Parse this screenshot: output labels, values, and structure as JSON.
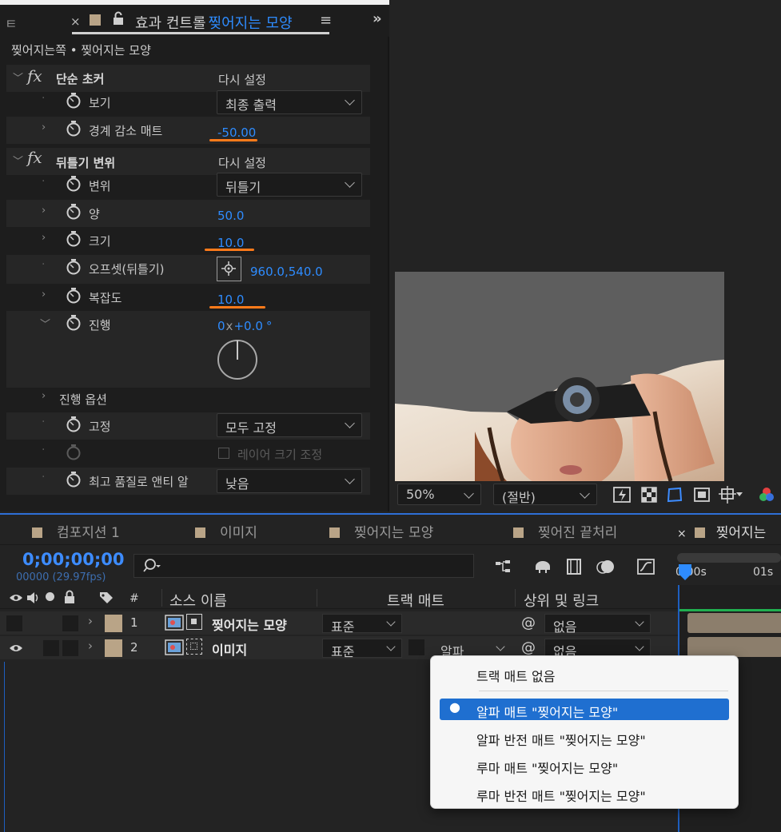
{
  "effect_panel": {
    "tab_left_fragment": "ㅌ",
    "tab_title_prefix": "효과 컨트롤",
    "tab_title_layer": "찢어지는 모양",
    "breadcrumb": "찢어지는쪽 • 찢어지는 모양",
    "effects": [
      {
        "name": "단순 초커",
        "reset": "다시 설정",
        "props": [
          {
            "label": "보기",
            "value": "최종 출력"
          },
          {
            "label": "경계 감소 매트",
            "value": "-50.00"
          }
        ]
      },
      {
        "name": "뒤틀기 변위",
        "reset": "다시 설정",
        "props": [
          {
            "label": "변위",
            "value": "뒤틀기"
          },
          {
            "label": "양",
            "value": "50.0"
          },
          {
            "label": "크기",
            "value": "10.0"
          },
          {
            "label": "오프셋(뒤틀기)",
            "value_x": "960.0",
            "value_y": ",540.0"
          },
          {
            "label": "복잡도",
            "value": "10.0"
          },
          {
            "label": "진행",
            "value_a": "0",
            "value_b": "x",
            "value_c": "+0.0",
            "value_d": "°"
          },
          {
            "label": "진행 옵션"
          },
          {
            "label": "고정",
            "value": "모두 고정"
          },
          {
            "label": "레이어 크기 조정"
          },
          {
            "label": "최고 품질로 앤티 알",
            "value": "낮음"
          }
        ]
      }
    ]
  },
  "viewer": {
    "zoom": "50%",
    "resolution": "(절반)"
  },
  "timeline": {
    "tabs": [
      "컴포지션 1",
      "이미지",
      "찢어지는 모양",
      "찢어진 끝처리",
      "찢어지는"
    ],
    "timecode": "0;00;00;00",
    "frame_info": "00000 (29.97fps)",
    "columns": {
      "num": "#",
      "source": "소스 이름",
      "track_matte": "트랙 매트",
      "parent": "상위 및 링크"
    },
    "ruler": [
      "0:00s",
      "01s"
    ],
    "layers": [
      {
        "num": "1",
        "name": "찢어지는 모양",
        "mode": "표준",
        "matte": "",
        "parent": "없음"
      },
      {
        "num": "2",
        "name": "이미지",
        "mode": "표준",
        "matte": "알파",
        "parent": "없음"
      }
    ]
  },
  "context_menu": {
    "items": [
      {
        "label": "트랙 매트 없음",
        "selected": false
      },
      {
        "label": "알파 매트 \"찢어지는 모양\"",
        "selected": true
      },
      {
        "label": "알파 반전 매트 \"찢어지는 모양\"",
        "selected": false
      },
      {
        "label": "루마 매트 \"찢어지는 모양\"",
        "selected": false
      },
      {
        "label": "루마 반전 매트 \"찢어지는 모양\"",
        "selected": false
      }
    ]
  },
  "colors": {
    "accent": "#2e8cff",
    "highlight": "#ff7a1a",
    "label_tan": "#b9a487",
    "menu_selected": "#1f6fd0"
  }
}
